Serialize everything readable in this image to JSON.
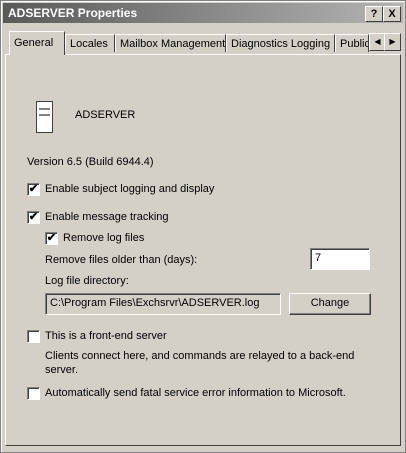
{
  "window": {
    "title": "ADSERVER Properties",
    "help_button": "?",
    "close_button": "X"
  },
  "tabs": [
    {
      "label": "General",
      "active": true
    },
    {
      "label": "Locales"
    },
    {
      "label": "Mailbox Management"
    },
    {
      "label": "Diagnostics Logging"
    },
    {
      "label": "Public"
    }
  ],
  "tab_scroll": {
    "left": "◀",
    "right": "▶"
  },
  "server": {
    "icon": "server-icon",
    "name": "ADSERVER",
    "version": "Version 6.5 (Build 6944.4)"
  },
  "options": {
    "subject_logging": {
      "label": "Enable subject logging and display",
      "checked": true
    },
    "message_tracking": {
      "label": "Enable message tracking",
      "checked": true
    },
    "remove_log_files": {
      "label": "Remove log files",
      "checked": true
    },
    "remove_older_label": "Remove files older than (days):",
    "remove_older_value": "7",
    "log_dir_label": "Log file directory:",
    "log_dir_value": "C:\\Program Files\\Exchsrvr\\ADSERVER.log",
    "change_button": "Change",
    "front_end": {
      "label": "This is a front-end server",
      "checked": false
    },
    "front_end_desc_1": "Clients connect here, and commands are relayed to a back-end",
    "front_end_desc_2": "server.",
    "fatal_error": {
      "label": "Automatically send fatal service error information to Microsoft.",
      "checked": false
    }
  },
  "check_mark": "✔"
}
